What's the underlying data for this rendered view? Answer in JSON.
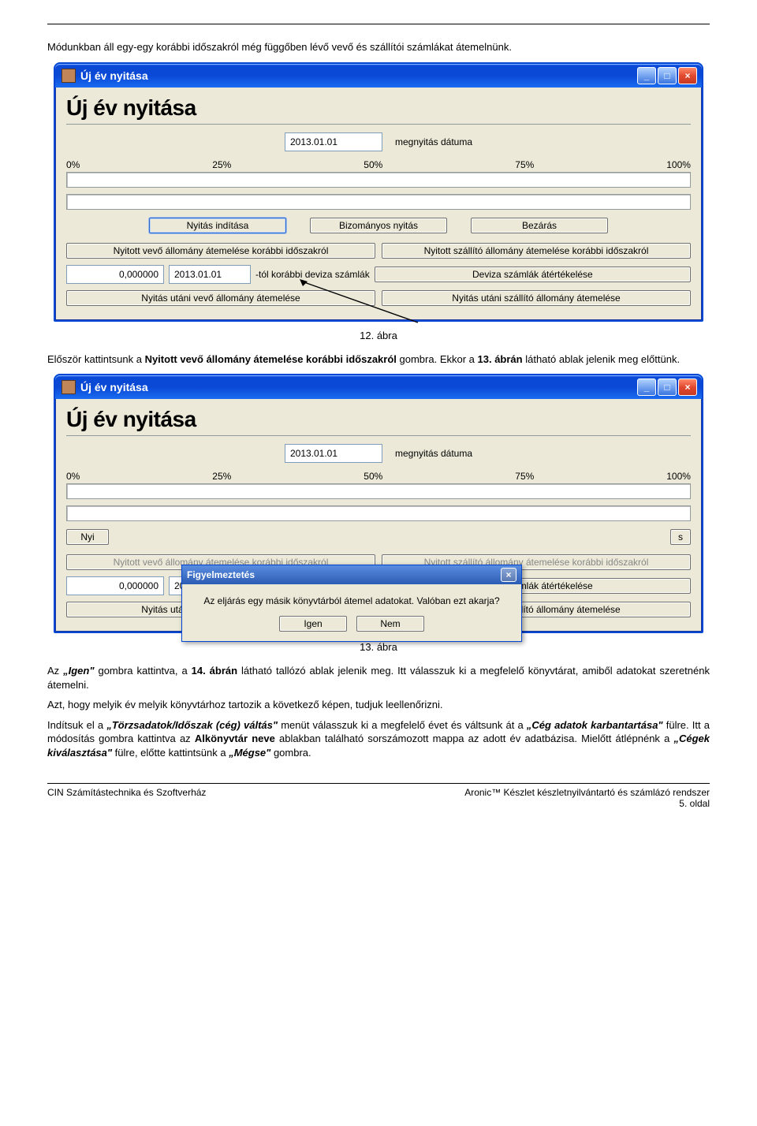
{
  "doc": {
    "intro": "Módunkban áll egy-egy korábbi időszakról még függőben lévő vevő és szállítói számlákat átemelnünk.",
    "fig12": "12. ábra",
    "p2a": "Először kattintsunk a ",
    "p2b": "Nyitott vevő állomány átemelése korábbi időszakról",
    "p2c": " gombra. Ekkor a ",
    "p2d": "13. ábrán",
    "p2e": " látható ablak jelenik meg előttünk.",
    "fig13": "13. ábra",
    "p3a": "Az ",
    "p3b": "„Igen\"",
    "p3c": " gombra kattintva, a ",
    "p3d": "14. ábrán",
    "p3e": " látható tallózó ablak jelenik meg. Itt válasszuk ki a megfelelő könyvtárat, amiből adatokat szeretnénk átemelni.",
    "p4": "Azt, hogy melyik év melyik könyvtárhoz tartozik a következő képen, tudjuk leellenőrizni.",
    "p5a": "Indítsuk el a ",
    "p5b": "„Törzsadatok/Időszak (cég) váltás\"",
    "p5c": " menüt válasszuk ki a megfelelő évet és váltsunk át a ",
    "p5d": "„Cég adatok karbantartása\"",
    "p5e": " fülre. Itt a módosítás gombra kattintva az ",
    "p5f": "Alkönyvtár neve",
    "p5g": " ablakban található sorszámozott mappa az adott év adatbázisa. Mielőtt átlépnénk a ",
    "p5h": "„Cégek kiválasztása\"",
    "p5i": " fülre, előtte kattintsünk a ",
    "p5j": "„Mégse\"",
    "p5k": " gombra."
  },
  "win": {
    "title": "Új év nyitása",
    "heading": "Új év nyitása",
    "date": "2013.01.01",
    "date_label": "megnyitás dátuma",
    "pct": {
      "p0": "0%",
      "p25": "25%",
      "p50": "50%",
      "p75": "75%",
      "p100": "100%"
    },
    "btn_start": "Nyitás indítása",
    "btn_biz": "Bizományos nyitás",
    "btn_close": "Bezárás",
    "btn_vevo": "Nyitott vevő állomány átemelése korábbi időszakról",
    "btn_szallito": "Nyitott szállító állomány átemelése korábbi időszakról",
    "dev_rate": "0,000000",
    "dev_date": "2013.01.01",
    "dev_label": "-tól korábbi deviza számlák",
    "btn_dev": "Deviza számlák átértékelése",
    "btn_post_vevo": "Nyitás utáni vevő állomány átemelése",
    "btn_post_szallito": "Nyitás utáni szállító állomány átemelése"
  },
  "confirm": {
    "title": "Figyelmeztetés",
    "msg": "Az eljárás egy másik könyvtárból átemel adatokat. Valóban ezt akarja?",
    "yes": "Igen",
    "no": "Nem"
  },
  "footer": {
    "left": "CIN Számítástechnika és Szoftverház",
    "right1": "Aronic™ Készlet készletnyilvántartó és számlázó rendszer",
    "right2": "5. oldal"
  }
}
